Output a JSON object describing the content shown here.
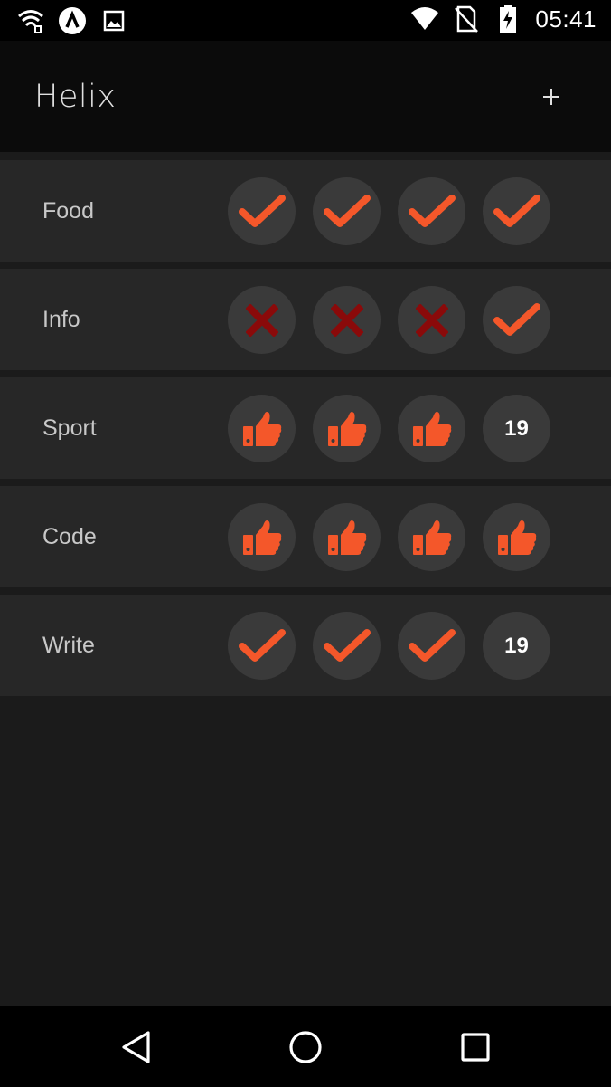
{
  "status_bar": {
    "time": "05:41",
    "icons": [
      "wifi-question-icon",
      "app-launcher-icon",
      "image-icon",
      "wifi-icon",
      "no-sim-icon",
      "battery-charging-icon"
    ]
  },
  "app": {
    "title": "Helix",
    "add_button": "+"
  },
  "colors": {
    "accent": "#f4572a",
    "fail": "#8a0a0a",
    "circle": "#3a3a3a",
    "row_bg": "#272727"
  },
  "habits": [
    {
      "name": "Food",
      "checks": [
        {
          "type": "check"
        },
        {
          "type": "check"
        },
        {
          "type": "check"
        },
        {
          "type": "check"
        }
      ]
    },
    {
      "name": "Info",
      "checks": [
        {
          "type": "cross"
        },
        {
          "type": "cross"
        },
        {
          "type": "cross"
        },
        {
          "type": "check"
        }
      ]
    },
    {
      "name": "Sport",
      "checks": [
        {
          "type": "thumb"
        },
        {
          "type": "thumb"
        },
        {
          "type": "thumb"
        },
        {
          "type": "number",
          "value": "19"
        }
      ]
    },
    {
      "name": "Code",
      "checks": [
        {
          "type": "thumb"
        },
        {
          "type": "thumb"
        },
        {
          "type": "thumb"
        },
        {
          "type": "thumb"
        }
      ]
    },
    {
      "name": "Write",
      "checks": [
        {
          "type": "check"
        },
        {
          "type": "check"
        },
        {
          "type": "check"
        },
        {
          "type": "number",
          "value": "19"
        }
      ]
    }
  ],
  "nav_bar": {
    "buttons": [
      "back-icon",
      "home-icon",
      "recents-icon"
    ]
  }
}
